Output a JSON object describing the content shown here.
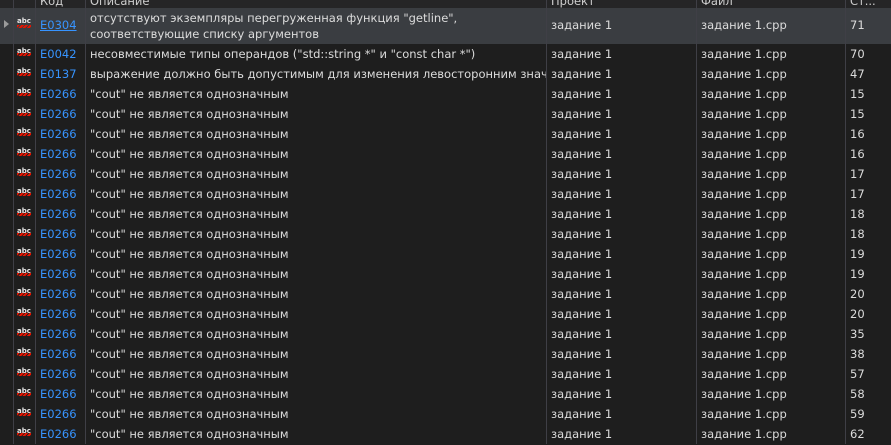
{
  "columns": [
    "",
    "Код",
    "Описание",
    "Проект",
    "Файл",
    "Ст..."
  ],
  "rows": [
    {
      "code": "E0304",
      "description": "отсутствуют экземпляры перегруженная функция \"getline\", соответствующие списку аргументов",
      "project": "задание 1",
      "file": "задание 1.cpp",
      "line": "71"
    },
    {
      "code": "E0042",
      "description": "несовместимые типы операндов (\"std::string *\" и \"const char *\")",
      "project": "задание 1",
      "file": "задание 1.cpp",
      "line": "70"
    },
    {
      "code": "E0137",
      "description": "выражение должно быть допустимым для изменения левосторонним значением",
      "project": "задание 1",
      "file": "задание 1.cpp",
      "line": "47"
    },
    {
      "code": "E0266",
      "description": "\"cout\" не является однозначным",
      "project": "задание 1",
      "file": "задание 1.cpp",
      "line": "15"
    },
    {
      "code": "E0266",
      "description": "\"cout\" не является однозначным",
      "project": "задание 1",
      "file": "задание 1.cpp",
      "line": "15"
    },
    {
      "code": "E0266",
      "description": "\"cout\" не является однозначным",
      "project": "задание 1",
      "file": "задание 1.cpp",
      "line": "16"
    },
    {
      "code": "E0266",
      "description": "\"cout\" не является однозначным",
      "project": "задание 1",
      "file": "задание 1.cpp",
      "line": "16"
    },
    {
      "code": "E0266",
      "description": "\"cout\" не является однозначным",
      "project": "задание 1",
      "file": "задание 1.cpp",
      "line": "17"
    },
    {
      "code": "E0266",
      "description": "\"cout\" не является однозначным",
      "project": "задание 1",
      "file": "задание 1.cpp",
      "line": "17"
    },
    {
      "code": "E0266",
      "description": "\"cout\" не является однозначным",
      "project": "задание 1",
      "file": "задание 1.cpp",
      "line": "18"
    },
    {
      "code": "E0266",
      "description": "\"cout\" не является однозначным",
      "project": "задание 1",
      "file": "задание 1.cpp",
      "line": "18"
    },
    {
      "code": "E0266",
      "description": "\"cout\" не является однозначным",
      "project": "задание 1",
      "file": "задание 1.cpp",
      "line": "19"
    },
    {
      "code": "E0266",
      "description": "\"cout\" не является однозначным",
      "project": "задание 1",
      "file": "задание 1.cpp",
      "line": "19"
    },
    {
      "code": "E0266",
      "description": "\"cout\" не является однозначным",
      "project": "задание 1",
      "file": "задание 1.cpp",
      "line": "20"
    },
    {
      "code": "E0266",
      "description": "\"cout\" не является однозначным",
      "project": "задание 1",
      "file": "задание 1.cpp",
      "line": "20"
    },
    {
      "code": "E0266",
      "description": "\"cout\" не является однозначным",
      "project": "задание 1",
      "file": "задание 1.cpp",
      "line": "35"
    },
    {
      "code": "E0266",
      "description": "\"cout\" не является однозначным",
      "project": "задание 1",
      "file": "задание 1.cpp",
      "line": "38"
    },
    {
      "code": "E0266",
      "description": "\"cout\" не является однозначным",
      "project": "задание 1",
      "file": "задание 1.cpp",
      "line": "57"
    },
    {
      "code": "E0266",
      "description": "\"cout\" не является однозначным",
      "project": "задание 1",
      "file": "задание 1.cpp",
      "line": "58"
    },
    {
      "code": "E0266",
      "description": "\"cout\" не является однозначным",
      "project": "задание 1",
      "file": "задание 1.cpp",
      "line": "59"
    },
    {
      "code": "E0266",
      "description": "\"cout\" не является однозначным",
      "project": "задание 1",
      "file": "задание 1.cpp",
      "line": "62"
    }
  ],
  "error_icon_text": "abc",
  "colors": {
    "code_link": "#3794ff",
    "squiggle": "#e51400",
    "selected_row": "#3a3d41"
  }
}
